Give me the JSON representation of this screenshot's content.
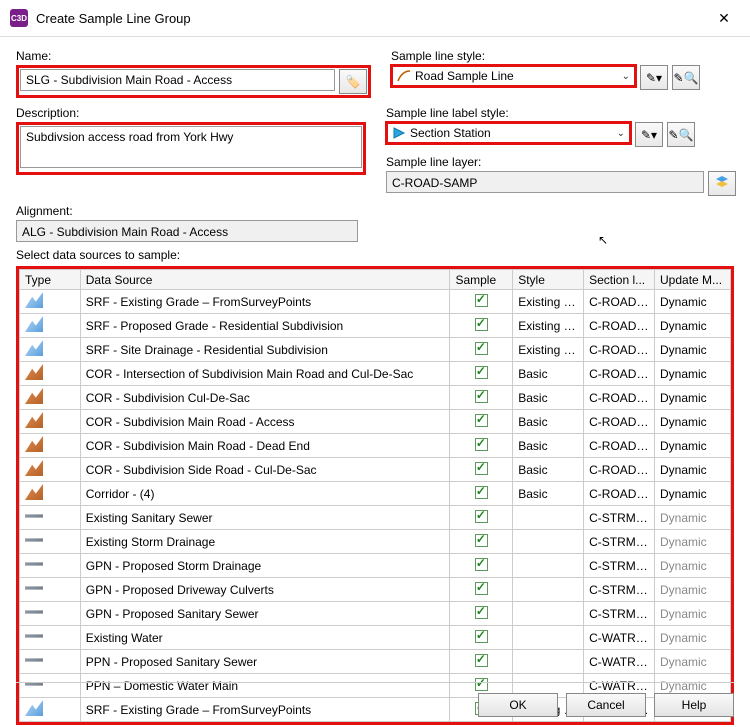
{
  "window": {
    "title": "Create Sample Line Group",
    "appIconText": "C3D"
  },
  "labels": {
    "name": "Name:",
    "description": "Description:",
    "alignment": "Alignment:",
    "sampleLineStyle": "Sample line style:",
    "sampleLineLabelStyle": "Sample line label style:",
    "sampleLineLayer": "Sample line layer:",
    "selectData": "Select data sources to sample:"
  },
  "fields": {
    "name": "SLG - Subdivision Main Road - Access",
    "description": "Subdivsion access road from York Hwy",
    "alignment": "ALG - Subdivision Main Road - Access",
    "sampleLineStyle": "Road Sample Line",
    "sampleLineLabelStyle": "Section Station",
    "sampleLineLayer": "C-ROAD-SAMP"
  },
  "grid": {
    "headers": {
      "type": "Type",
      "ds": "Data Source",
      "sample": "Sample",
      "style": "Style",
      "layer": "Section l...",
      "update": "Update M..."
    },
    "rows": [
      {
        "icon": "srf",
        "ds": "SRF - Existing Grade – FromSurveyPoints",
        "style": "Existing G...",
        "layer": "C-ROAD-...",
        "update": "Dynamic",
        "muted": false
      },
      {
        "icon": "srf",
        "ds": "SRF - Proposed Grade - Residential Subdivision",
        "style": "Existing G...",
        "layer": "C-ROAD-...",
        "update": "Dynamic",
        "muted": false
      },
      {
        "icon": "srf",
        "ds": "SRF - Site Drainage - Residential Subdivision",
        "style": "Existing G...",
        "layer": "C-ROAD-...",
        "update": "Dynamic",
        "muted": false
      },
      {
        "icon": "cor",
        "ds": "COR - Intersection of Subdivision Main Road and Cul-De-Sac",
        "style": "Basic",
        "layer": "C-ROAD-...",
        "update": "Dynamic",
        "muted": false
      },
      {
        "icon": "cor",
        "ds": "COR - Subdivision Cul-De-Sac",
        "style": "Basic",
        "layer": "C-ROAD-...",
        "update": "Dynamic",
        "muted": false
      },
      {
        "icon": "cor",
        "ds": "COR - Subdivision Main Road - Access",
        "style": "Basic",
        "layer": "C-ROAD-...",
        "update": "Dynamic",
        "muted": false
      },
      {
        "icon": "cor",
        "ds": "COR - Subdivision Main Road - Dead End",
        "style": "Basic",
        "layer": "C-ROAD-...",
        "update": "Dynamic",
        "muted": false
      },
      {
        "icon": "cor",
        "ds": "COR - Subdivision Side Road - Cul-De-Sac",
        "style": "Basic",
        "layer": "C-ROAD-...",
        "update": "Dynamic",
        "muted": false
      },
      {
        "icon": "cor",
        "ds": "Corridor - (4)",
        "style": "Basic",
        "layer": "C-ROAD-...",
        "update": "Dynamic",
        "muted": false
      },
      {
        "icon": "pipe",
        "ds": "Existing Sanitary Sewer",
        "style": "",
        "layer": "C-STRM-...",
        "update": "Dynamic",
        "muted": true
      },
      {
        "icon": "pipe",
        "ds": "Existing Storm Drainage",
        "style": "",
        "layer": "C-STRM-...",
        "update": "Dynamic",
        "muted": true
      },
      {
        "icon": "pipe",
        "ds": "GPN - Proposed Storm Drainage",
        "style": "",
        "layer": "C-STRM-...",
        "update": "Dynamic",
        "muted": true
      },
      {
        "icon": "pipe",
        "ds": "GPN - Proposed Driveway Culverts",
        "style": "",
        "layer": "C-STRM-...",
        "update": "Dynamic",
        "muted": true
      },
      {
        "icon": "pipe",
        "ds": "GPN - Proposed Sanitary Sewer",
        "style": "",
        "layer": "C-STRM-...",
        "update": "Dynamic",
        "muted": true
      },
      {
        "icon": "pipe",
        "ds": "Existing Water",
        "style": "",
        "layer": "C-WATR-...",
        "update": "Dynamic",
        "muted": true
      },
      {
        "icon": "pipe",
        "ds": "PPN - Proposed Sanitary Sewer",
        "style": "",
        "layer": "C-WATR-...",
        "update": "Dynamic",
        "muted": true
      },
      {
        "icon": "pipe",
        "ds": "PPN – Domestic Water Main",
        "style": "",
        "layer": "C-WATR-...",
        "update": "Dynamic",
        "muted": true
      },
      {
        "icon": "srf",
        "ds": "SRF - Existing Grade – FromSurveyPoints",
        "style": "Existing G...",
        "layer": "C-ROAD-...",
        "update": "Dynamic",
        "muted": false
      }
    ]
  },
  "buttons": {
    "ok": "OK",
    "cancel": "Cancel",
    "help": "Help"
  }
}
